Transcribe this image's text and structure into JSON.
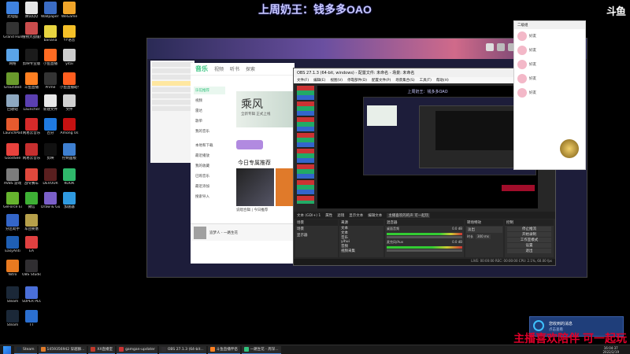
{
  "overlay": {
    "title": "上周奶王：钱多多OAO",
    "brand": "斗鱼",
    "bottom_banner": "主播喜欢陪伴 可一起玩"
  },
  "desktop_icons": [
    {
      "label": "此电脑",
      "color": "#3f82e0"
    },
    {
      "label": "腾讯QQ",
      "color": "#e6e6e6"
    },
    {
      "label": "Grand Hunger",
      "color": "#333"
    },
    {
      "label": "植物大战僵尸",
      "color": "#c94c4c"
    },
    {
      "label": "网络",
      "color": "#5aa4e8"
    },
    {
      "label": "剪映专业版",
      "color": "#1b1b1b"
    },
    {
      "label": "Grounded",
      "color": "#6a9a2c"
    },
    {
      "label": "斗鱼直播",
      "color": "#ff7f21"
    },
    {
      "label": "回收站",
      "color": "#8ea8c0"
    },
    {
      "label": "Launcher",
      "color": "#5a3fb0"
    },
    {
      "label": "LaunchPad",
      "color": "#e65a2e"
    },
    {
      "label": "网易云音乐",
      "color": "#d52a2a"
    },
    {
      "label": "GoodSee",
      "color": "#e8423d"
    },
    {
      "label": "网易云音乐",
      "color": "#c62f2f"
    },
    {
      "label": "AVBS 游戏",
      "color": "#7c7c7c"
    },
    {
      "label": "战令赛车",
      "color": "#e0483c"
    },
    {
      "label": "GeForce Experience",
      "color": "#66b32e"
    },
    {
      "label": "微信",
      "color": "#3eb035"
    },
    {
      "label": "分区助手",
      "color": "#3466c8"
    },
    {
      "label": "军团要塞",
      "color": "#b6a04a"
    },
    {
      "label": "EasyAnti",
      "color": "#1f5fb4"
    },
    {
      "label": "EA",
      "color": "#e04040"
    },
    {
      "label": "Nitro",
      "color": "#e87a20"
    },
    {
      "label": "OBS Studio",
      "color": "#302e31"
    },
    {
      "label": "Steam",
      "color": "#1b2838"
    },
    {
      "label": "SUPER PEOPLE",
      "color": "#4a6fd8"
    },
    {
      "label": "Steam",
      "color": "#1b2838"
    },
    {
      "label": "TT",
      "color": "#2b6fd0"
    },
    {
      "label": "Wallpaper Engine",
      "color": "#3b6cc4"
    },
    {
      "label": "WeGame",
      "color": "#f0a52a"
    },
    {
      "label": "banana",
      "color": "#e8d440"
    },
    {
      "label": "YY语音",
      "color": "#f5c028"
    },
    {
      "label": "小鱼直播",
      "color": "#ff6b22"
    },
    {
      "label": "yitai",
      "color": "#ccc"
    },
    {
      "label": "Prime",
      "color": "#333"
    },
    {
      "label": "小鱼直播助手",
      "color": "#ff5e1f"
    },
    {
      "label": "新建文件",
      "color": "#e8e8e8"
    },
    {
      "label": "文件",
      "color": "#d0d0d0"
    },
    {
      "label": "百分",
      "color": "#1f7ae0"
    },
    {
      "label": "Among Us",
      "color": "#c51111"
    },
    {
      "label": "剪映",
      "color": "#111"
    },
    {
      "label": "控制面板",
      "color": "#3e7fd0"
    },
    {
      "label": "DEVOUR",
      "color": "#5a1f1f"
    },
    {
      "label": "KOOK",
      "color": "#2fb86b"
    },
    {
      "label": "Draw & Guess",
      "color": "#7a5fc8"
    },
    {
      "label": "加速器",
      "color": "#2f9ae0"
    }
  ],
  "music_app": {
    "title": "音乐",
    "tabs": [
      "音乐",
      "视频",
      "听书",
      "探索"
    ],
    "nav": [
      "乐馆推荐",
      "视频",
      "雷达",
      "歌单",
      "我的音乐",
      "本地和下载",
      "最近播放",
      "我的收藏",
      "已购音乐",
      "最近添加",
      "搜索导入"
    ],
    "banner_text": "乘风",
    "banner_sub": "全新专辑 正式上线",
    "section_title": "今日专属推荐",
    "card1_text": "说唱合辑 | 今日推荐",
    "player_song": "追梦人 - 一路生花",
    "user": "QQ音乐"
  },
  "obs": {
    "title": "OBS 27.1.3 (64-bit, windows) - 配置文件: 未命名 - 场景: 未命名",
    "menu": [
      "文件(F)",
      "编辑(E)",
      "视图(V)",
      "停靠部件(D)",
      "配置文件(P)",
      "场景集合(S)",
      "工具(T)",
      "帮助(H)"
    ],
    "inner_title": "上周奶王：钱多多OAO",
    "source_bar": "文本 (GDI+) 1",
    "source_tools": [
      "属性",
      "滤镜",
      "显示文本",
      "编辑文本",
      "主播喜欢的的声 可一起玩"
    ],
    "panels": [
      "场景",
      "来源",
      "混音器",
      "转场特效",
      "控制"
    ],
    "scenes": [
      "场景",
      "显示器"
    ],
    "sources": [
      "文本",
      "文本",
      "音乐",
      "yihui",
      "音频",
      "视频采集"
    ],
    "mixer": [
      "桌面音频",
      "麦克风/Aux"
    ],
    "mixer_values": [
      "0.0 dB",
      "0.0 dB"
    ],
    "transition": "淡出",
    "duration_label": "时长",
    "duration": "300 ms",
    "controls": [
      "停止推流",
      "开始录制",
      "工作室模式",
      "设置",
      "退出"
    ],
    "status": "LIVE: 00:00:00  REC: 00:00:00  CPU: 2.1%, 60.00 fps"
  },
  "qq_sidebar": {
    "contacts": [
      "好友",
      "好友",
      "好友",
      "好友",
      "好友"
    ],
    "title": "二级组"
  },
  "notification": {
    "title": "您收到的消息",
    "subtitle": "点击查看"
  },
  "taskbar": {
    "items": [
      {
        "label": "Steam",
        "color": "#1b2838"
      },
      {
        "label": "1459356942 穿越群...",
        "color": "#e07a2a"
      },
      {
        "label": "XX直播室",
        "color": "#c0392b"
      },
      {
        "label": "gamgan-updater",
        "color": "#c33"
      },
      {
        "label": "OBS 27.1.3 (64-bit...",
        "color": "#302e31"
      },
      {
        "label": "斗鱼直播伴侣",
        "color": "#ff7f21"
      },
      {
        "label": "一路生花 - 周深...",
        "color": "#31c27c"
      }
    ],
    "time": "16:04:37",
    "date": "2022/2/19"
  },
  "colors": {
    "accent": "#4b8ad8",
    "obs_bg": "#272727",
    "music_accent": "#31c27c",
    "banner_red": "#e0002a"
  }
}
